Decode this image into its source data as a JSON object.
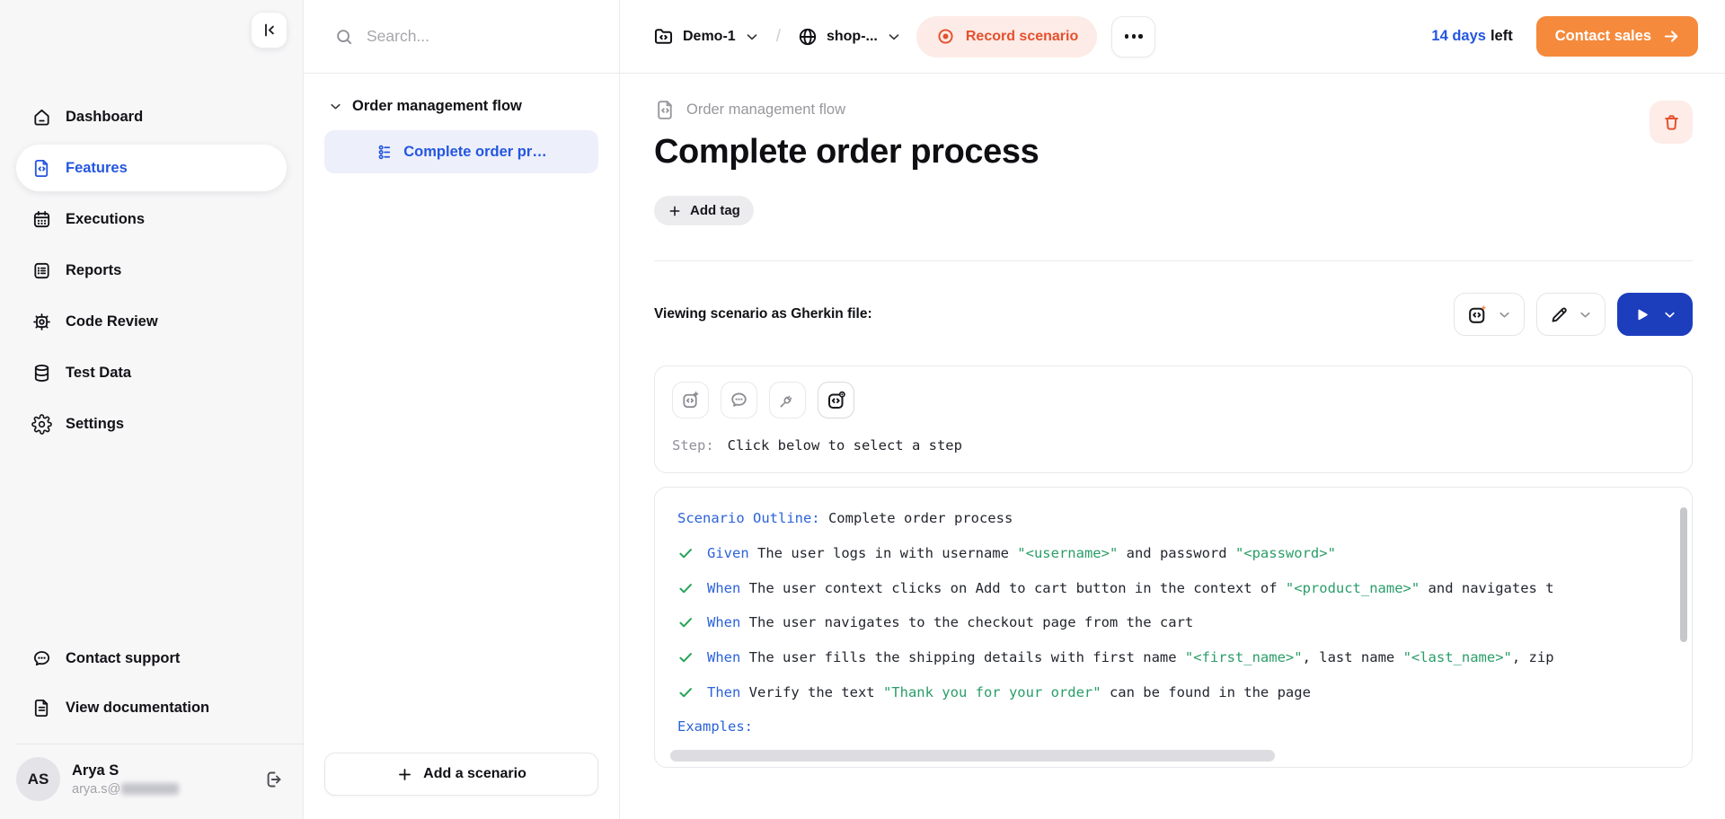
{
  "colors": {
    "accent_blue": "#2456e1",
    "run_button_blue": "#1c3ebd",
    "record_red": "#e5502e",
    "record_bg": "#fcebe6",
    "contact_sales_orange": "#f58a3c",
    "code_keyword_blue": "#2b63d9",
    "code_string_green": "#2a9d68",
    "check_green": "#23a455"
  },
  "sidebar": {
    "items": [
      {
        "label": "Dashboard",
        "active": false
      },
      {
        "label": "Features",
        "active": true
      },
      {
        "label": "Executions",
        "active": false
      },
      {
        "label": "Reports",
        "active": false
      },
      {
        "label": "Code Review",
        "active": false
      },
      {
        "label": "Test Data",
        "active": false
      },
      {
        "label": "Settings",
        "active": false
      }
    ],
    "footer_items": [
      {
        "label": "Contact support"
      },
      {
        "label": "View documentation"
      }
    ],
    "user": {
      "initials": "AS",
      "name": "Arya S",
      "email_prefix": "arya.s@"
    }
  },
  "explorer": {
    "search_placeholder": "Search...",
    "group_label": "Order management flow",
    "scenario_label": "Complete order pr…",
    "add_scenario_label": "Add a scenario"
  },
  "topbar": {
    "project_label": "Demo-1",
    "separator": "/",
    "app_label": "shop-...",
    "record_label": "Record scenario",
    "trial_days": "14 days",
    "trial_left": "left",
    "contact_sales_label": "Contact sales"
  },
  "content": {
    "feature_label": "Order management flow",
    "title": "Complete order process",
    "add_tag_label": "Add tag",
    "viewing_label": "Viewing scenario as Gherkin file:",
    "step_prefix": "Step:",
    "step_placeholder": "Click below to select a step"
  },
  "code": {
    "lines": [
      {
        "check": false,
        "segments": [
          [
            "kw",
            "Scenario Outline:"
          ],
          [
            "p",
            " Complete order process"
          ]
        ]
      },
      {
        "check": true,
        "segments": [
          [
            "kw",
            "Given"
          ],
          [
            "p",
            " The user logs in with username "
          ],
          [
            "str",
            "\"<username>\""
          ],
          [
            "p",
            " and password "
          ],
          [
            "str",
            "\"<password>\""
          ]
        ]
      },
      {
        "check": true,
        "segments": [
          [
            "kw",
            "When"
          ],
          [
            "p",
            " The user context clicks on Add to cart button in the context of "
          ],
          [
            "str",
            "\"<product_name>\""
          ],
          [
            "p",
            " and navigates t"
          ]
        ]
      },
      {
        "check": true,
        "segments": [
          [
            "kw",
            "When"
          ],
          [
            "p",
            " The user navigates to the checkout page from the cart"
          ]
        ]
      },
      {
        "check": true,
        "segments": [
          [
            "kw",
            "When"
          ],
          [
            "p",
            " The user fills the shipping details with first name "
          ],
          [
            "str",
            "\"<first_name>\""
          ],
          [
            "p",
            ", last name "
          ],
          [
            "str",
            "\"<last_name>\""
          ],
          [
            "p",
            ", zip"
          ]
        ]
      },
      {
        "check": true,
        "segments": [
          [
            "kw",
            "Then"
          ],
          [
            "p",
            " Verify the text "
          ],
          [
            "str",
            "\"Thank you for your order\""
          ],
          [
            "p",
            " can be found in the page"
          ]
        ]
      },
      {
        "check": false,
        "segments": [
          [
            "kw",
            "Examples:"
          ]
        ]
      }
    ]
  }
}
